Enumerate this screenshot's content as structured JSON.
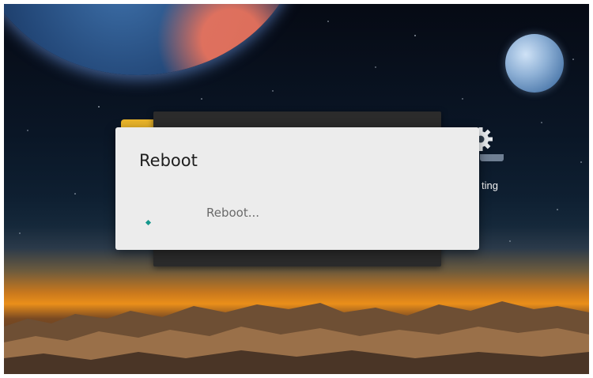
{
  "dialog": {
    "title": "Reboot",
    "message": "Reboot..."
  },
  "desktop": {
    "setting_label_visible": "ting"
  },
  "icons": {
    "folder": "folder-icon",
    "gear": "gear-icon",
    "spinner": "spinner-icon"
  },
  "colors": {
    "dialog_background": "#ececec",
    "accent": "#15978c",
    "background_panel": "#2b2b2b"
  }
}
